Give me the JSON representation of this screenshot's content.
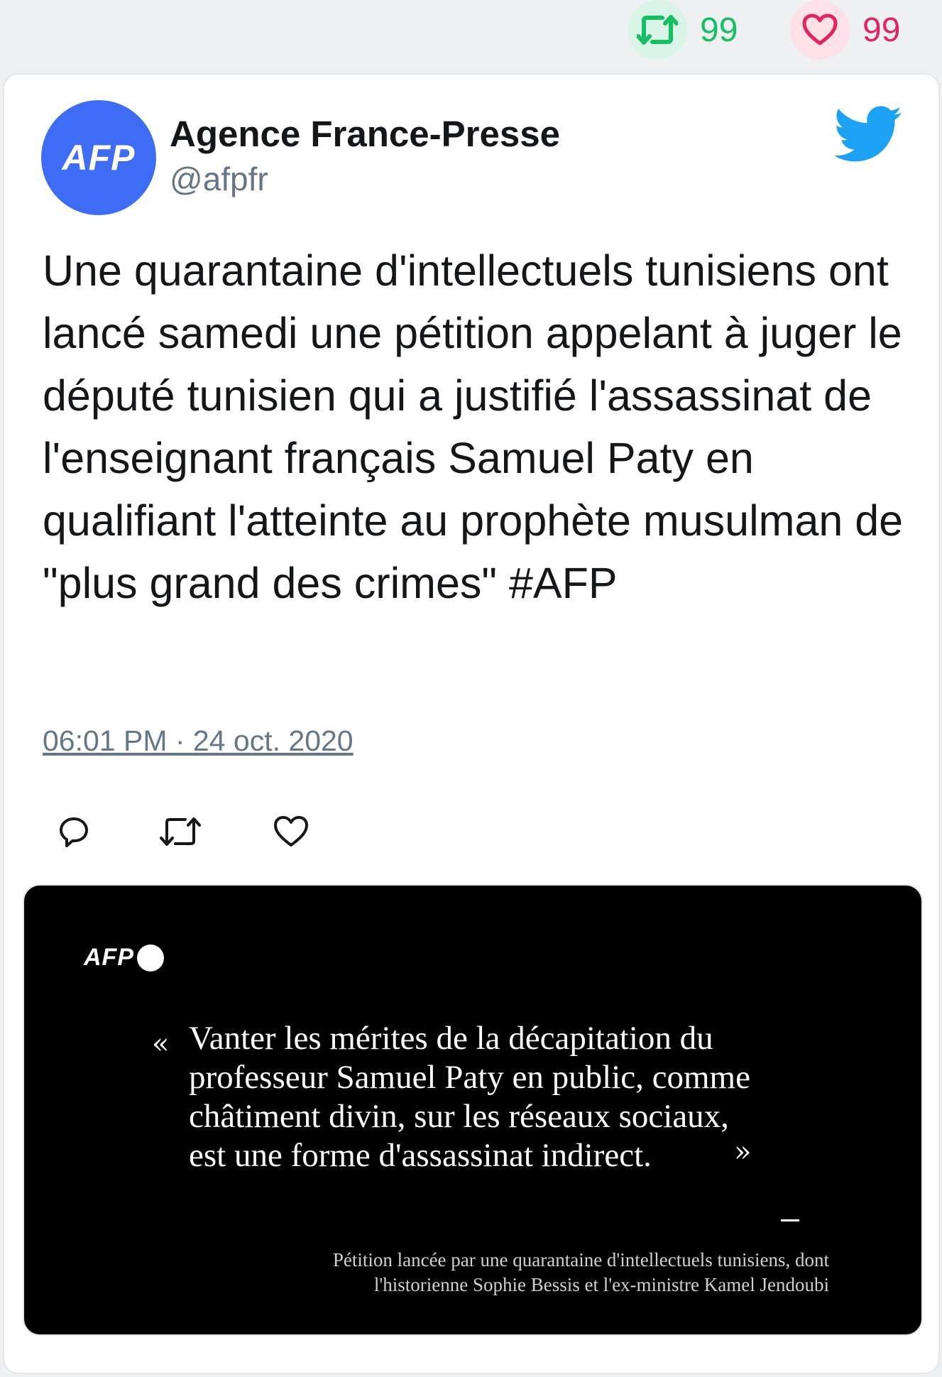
{
  "stats": {
    "retweet_count": "99",
    "like_count": "99"
  },
  "colors": {
    "retweet": "#17bf63",
    "like": "#e0245e",
    "twitter_blue": "#1da1f2",
    "afp_blue": "#3f6cf4"
  },
  "icons": {
    "retweet": "retweet-icon",
    "like": "heart-icon",
    "reply": "reply-icon",
    "brand": "twitter-bird-icon"
  },
  "tweet": {
    "avatar_text": "AFP",
    "author_name": "Agence France-Presse",
    "author_handle": "@afpfr",
    "text": "Une quarantaine d'intellectuels tunisiens ont lancé samedi une pétition appelant à juger le député tunisien qui a justifié l'assassinat de l'enseignant français Samuel Paty en qualifiant l'atteinte au prophète musulman de \"plus grand des crimes\" #AFP",
    "timestamp": "06:01 PM · 24 oct. 2020"
  },
  "media": {
    "logo_text": "AFP",
    "quote_open": "«",
    "quote_lines": [
      "Vanter les mérites de la décapitation du",
      "professeur Samuel Paty en public, comme",
      "châtiment divin, sur les réseaux sociaux,",
      "est une forme d'assassinat indirect."
    ],
    "quote_close": "»",
    "caption_lines": [
      "Pétition lancée par une quarantaine d'intellectuels tunisiens, dont",
      "l'historienne Sophie Bessis et l'ex-ministre Kamel Jendoubi"
    ]
  }
}
